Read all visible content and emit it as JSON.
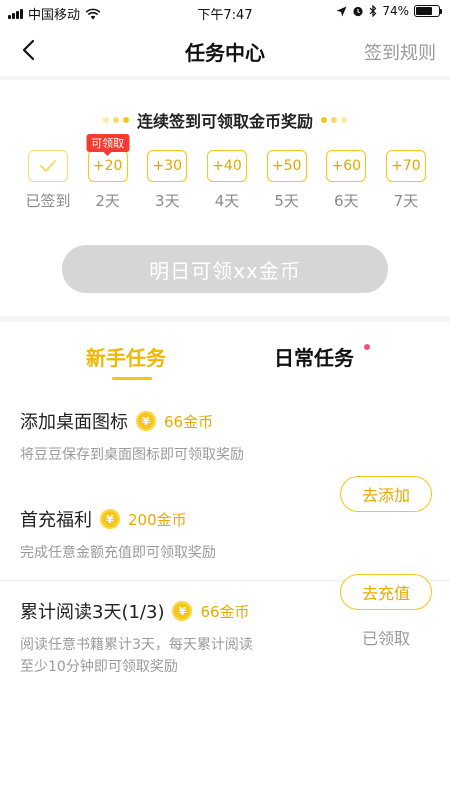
{
  "status_bar": {
    "carrier": "中国移动",
    "time": "下午7:47",
    "battery": "74%",
    "battery_level": 0.74
  },
  "nav": {
    "title": "任务中心",
    "rules_label": "签到规则",
    "back_icon": "chevron-left-icon"
  },
  "signin": {
    "heading": "连续签到可领取金币奖励",
    "claim_tag": "可领取",
    "days": [
      {
        "reward": "",
        "label": "已签到",
        "done": true
      },
      {
        "reward": "+20",
        "label": "2天"
      },
      {
        "reward": "+30",
        "label": "3天"
      },
      {
        "reward": "+40",
        "label": "4天"
      },
      {
        "reward": "+50",
        "label": "5天"
      },
      {
        "reward": "+60",
        "label": "6天"
      },
      {
        "reward": "+70",
        "label": "7天"
      }
    ],
    "tomorrow_button": "明日可领xx金币"
  },
  "tabs": {
    "new": "新手任务",
    "daily": "日常任务"
  },
  "tasks": [
    {
      "title": "添加桌面图标",
      "reward": "66金币",
      "desc": "将豆豆保存到桌面图标即可领取奖励",
      "action": "去添加"
    },
    {
      "title": "首充福利",
      "reward": "200金币",
      "desc": "完成任意金额充值即可领取奖励",
      "action": "去充值"
    },
    {
      "title": "累计阅读3天(1/3)",
      "reward": "66金币",
      "desc_line1": "阅读任意书籍累计3天，每天累计阅读",
      "desc_line2": "至少10分钟即可领取奖励",
      "status": "已领取"
    }
  ],
  "coin_symbol": "¥",
  "colors": {
    "accent": "#f5c518",
    "accent_text": "#e8a900",
    "tag_red": "#f53b32",
    "disabled_button": "#d6d6d6",
    "notification_dot": "#f0508a"
  }
}
